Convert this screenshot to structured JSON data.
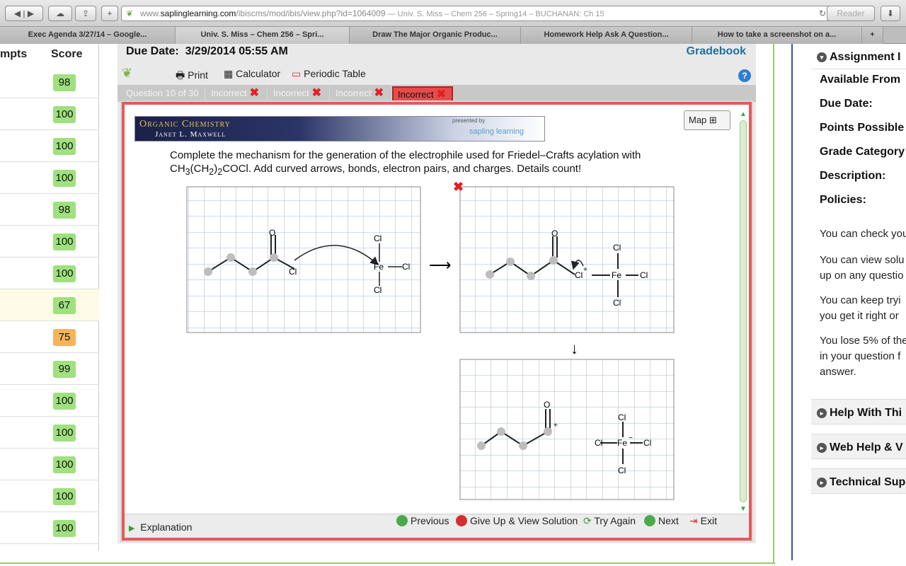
{
  "browser": {
    "url_prefix": "www.",
    "url_host": "saplinglearning.com",
    "url_path": "/ibiscms/mod/ibis/view.php?id=1064009",
    "page_title": " — Univ. S. Miss – Chem 256 – Spring14 – BUCHANAN: Ch 15",
    "reader": "Reader",
    "tabs": [
      "Exec Agenda 3/27/14 – Google...",
      "Univ. S. Miss – Chem 256 – Spri...",
      "Draw The Major Organic Produc...",
      "Homework Help Ask A Question...",
      "How to take a screenshot on a..."
    ]
  },
  "score_column": {
    "attempts_header": "mpts",
    "score_header": "Score",
    "scores": [
      "98",
      "100",
      "100",
      "100",
      "98",
      "100",
      "100",
      "67",
      "75",
      "99",
      "100",
      "100",
      "100",
      "100",
      "100"
    ],
    "highlight_index": 7,
    "orange_index": 8
  },
  "assignment": {
    "due_label": "Due Date:",
    "due_value": "3/29/2014 05:55 AM",
    "gradebook": "Gradebook",
    "tools": {
      "print": "Print",
      "calculator": "Calculator",
      "periodic_table": "Periodic Table"
    },
    "question_tabs": [
      "Question 10 of 30",
      "Incorrect",
      "Incorrect",
      "Incorrect",
      "Incorrect"
    ],
    "banner": {
      "line1": "Organic Chemistry",
      "line2": "Janet L. Maxwell",
      "presented_by": "presented by",
      "brand": "sapling learning"
    },
    "map_label": "Map",
    "question_line1": "Complete the mechanism for the generation of the electrophile used for Friedel–Crafts acylation with",
    "question_line2_a": "CH",
    "question_line2_b": "3",
    "question_line2_c": "(CH",
    "question_line2_d": "2",
    "question_line2_e": ")",
    "question_line2_f": "2",
    "question_line2_g": "COCl. Add curved arrows, bonds, electron pairs, and charges. Details count!",
    "bottom": {
      "explanation": "Explanation",
      "previous": "Previous",
      "give_up": "Give Up & View Solution",
      "try_again": "Try Again",
      "next": "Next",
      "exit": "Exit"
    },
    "chem": {
      "O": "O",
      "Cl": "Cl",
      "Fe": "Fe",
      "plus": "+",
      "minus": "−"
    }
  },
  "info_panel": {
    "header": "Assignment I",
    "available_from": "Available From",
    "due_date": "Due Date:",
    "points_possible": "Points Possible",
    "grade_category": "Grade Category",
    "description": "Description:",
    "policies": "Policies:",
    "p1": "You can check you",
    "p2a": "You can view solu",
    "p2b": "up on any questio",
    "p3a": "You can keep tryi",
    "p3b": "you get it right or",
    "p4a": "You lose 5% of the",
    "p4b": "in your question f",
    "p4c": "answer.",
    "sec1": "Help With Thi",
    "sec2": "Web Help & V",
    "sec3": "Technical Sup"
  }
}
